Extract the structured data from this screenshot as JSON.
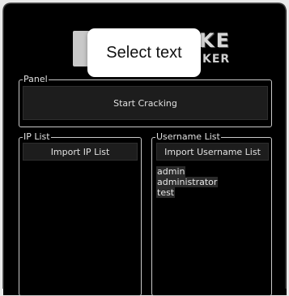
{
  "tooltip": {
    "text": "Select text"
  },
  "brand": {
    "line1": "KE",
    "line2": "KER",
    "logo_icon": "windows-flag-icon"
  },
  "panel": {
    "legend": "Panel",
    "crack_button_label": "Start Cracking"
  },
  "ip_list": {
    "legend": "IP List",
    "import_button_label": "Import IP List",
    "items": []
  },
  "username_list": {
    "legend": "Username List",
    "import_button_label": "Import Username List",
    "items": [
      "admin",
      "administrator",
      "test"
    ]
  },
  "colors": {
    "window_bg": "#000000",
    "text": "#e0e0e0",
    "button_bg": "#1d1d1d",
    "group_border": "#c8c8c8",
    "tooltip_bg": "#ffffff"
  }
}
